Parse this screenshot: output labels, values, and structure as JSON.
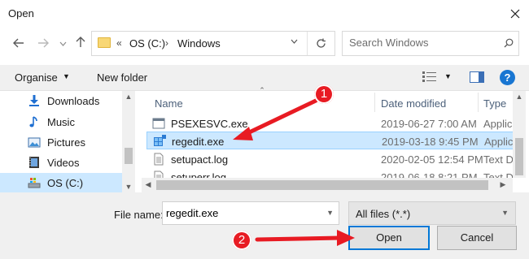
{
  "window": {
    "title": "Open"
  },
  "address": {
    "segments": [
      "OS (C:)",
      "Windows"
    ],
    "search_placeholder": "Search Windows"
  },
  "toolbar": {
    "organise": "Organise",
    "new_folder": "New folder"
  },
  "nav": {
    "items": [
      {
        "label": "Downloads",
        "icon": "download-icon"
      },
      {
        "label": "Music",
        "icon": "music-note-icon"
      },
      {
        "label": "Pictures",
        "icon": "pictures-icon"
      },
      {
        "label": "Videos",
        "icon": "videos-icon"
      },
      {
        "label": "OS (C:)",
        "icon": "drive-icon",
        "selected": true
      }
    ]
  },
  "files": {
    "columns": [
      "Name",
      "Date modified",
      "Type"
    ],
    "rows": [
      {
        "name": "PSEXESVC.exe",
        "date": "2019-06-27 7:00 AM",
        "type": "Applica"
      },
      {
        "name": "regedit.exe",
        "date": "2019-03-18 9:45 PM",
        "type": "Applica",
        "selected": true
      },
      {
        "name": "setupact.log",
        "date": "2020-02-05 12:54 PM",
        "type": "Text Do"
      },
      {
        "name": "setuperr.log",
        "date": "2019-06-18 8:21 PM",
        "type": "Text Do"
      }
    ]
  },
  "bottom": {
    "file_name_label": "File name:",
    "file_name_value": "regedit.exe",
    "file_type": "All files (*.*)",
    "open": "Open",
    "cancel": "Cancel"
  },
  "annotations": {
    "callout1": "1",
    "callout2": "2",
    "color": "#e81b23"
  }
}
